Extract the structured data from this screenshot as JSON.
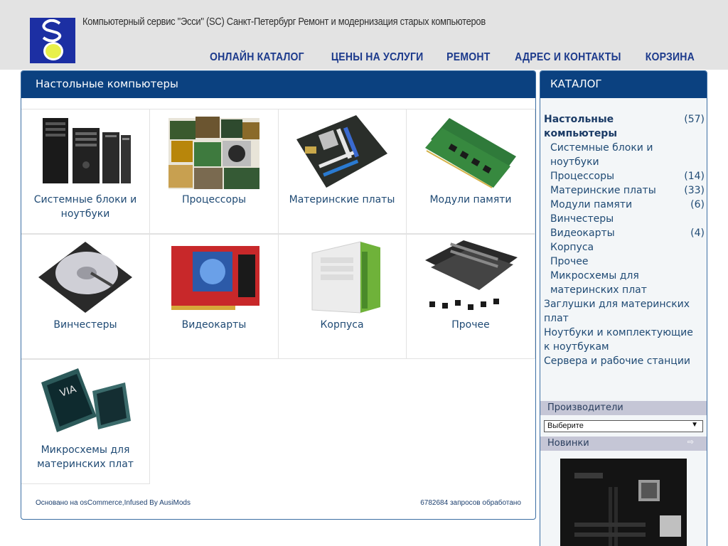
{
  "header": {
    "logo_name": "SC",
    "site_title": "Компьютерный сервис \"Эсси\" (SC) Санкт-Петербург Ремонт и модернизация старых компьютеров",
    "nav": [
      "ОНЛАЙН КАТАЛОГ",
      "ЦЕНЫ НА УСЛУГИ",
      "РЕМОНТ",
      "АДРЕС И КОНТАКТЫ",
      "КОРЗИНА"
    ]
  },
  "main": {
    "title": "Настольные компьютеры",
    "tiles": [
      {
        "label": "Системные блоки и ноутбуки",
        "icon": "pc-towers-image"
      },
      {
        "label": "Процессоры",
        "icon": "cpu-pile-image"
      },
      {
        "label": "Материнские платы",
        "icon": "motherboard-image"
      },
      {
        "label": "Модули памяти",
        "icon": "ram-modules-image"
      },
      {
        "label": "Винчестеры",
        "icon": "hard-drive-image"
      },
      {
        "label": "Видеокарты",
        "icon": "graphics-card-image"
      },
      {
        "label": "Корпуса",
        "icon": "pc-case-image"
      },
      {
        "label": "Прочее",
        "icon": "heatsink-image"
      },
      {
        "label": "Микросхемы для материнских плат",
        "icon": "chipset-image"
      }
    ],
    "footer_left": "Основано на osCommerce,Infused By AusiMods",
    "footer_right": "6782684 запросов обработано"
  },
  "sidebar": {
    "title": "КАТАЛОГ",
    "categories": [
      {
        "name": "Настольные компьютеры",
        "count": "(57)",
        "level": 0,
        "active": true
      },
      {
        "name": "Системные блоки и ноутбуки",
        "count": "",
        "level": 1
      },
      {
        "name": "Процессоры",
        "count": "(14)",
        "level": 1
      },
      {
        "name": "Материнские платы",
        "count": "(33)",
        "level": 1
      },
      {
        "name": "Модули памяти",
        "count": "(6)",
        "level": 1
      },
      {
        "name": "Винчестеры",
        "count": "",
        "level": 1
      },
      {
        "name": "Видеокарты",
        "count": "(4)",
        "level": 1
      },
      {
        "name": "Корпуса",
        "count": "",
        "level": 1
      },
      {
        "name": "Прочее",
        "count": "",
        "level": 1
      },
      {
        "name": "Микросхемы для материнских плат",
        "count": "",
        "level": 1
      },
      {
        "name": "Заглушки для материнских плат",
        "count": "",
        "level": 0
      },
      {
        "name": "Ноутбуки и комплектующие к ноутбукам",
        "count": "",
        "level": 0
      },
      {
        "name": "Сервера и рабочие станции",
        "count": "",
        "level": 0
      }
    ],
    "manufacturers_title": "Производители",
    "manufacturers_select": "Выберите",
    "news_title": "Новинки",
    "news_arrow": "⇨"
  },
  "colors": {
    "header_bg": "#e3e3e3",
    "panel_head_bg": "#0b4180",
    "nav_text": "#1c3a8c",
    "link_text": "#1f4a74",
    "logo_bg": "#1c2fa3",
    "logo_accent": "#e8f04a"
  }
}
